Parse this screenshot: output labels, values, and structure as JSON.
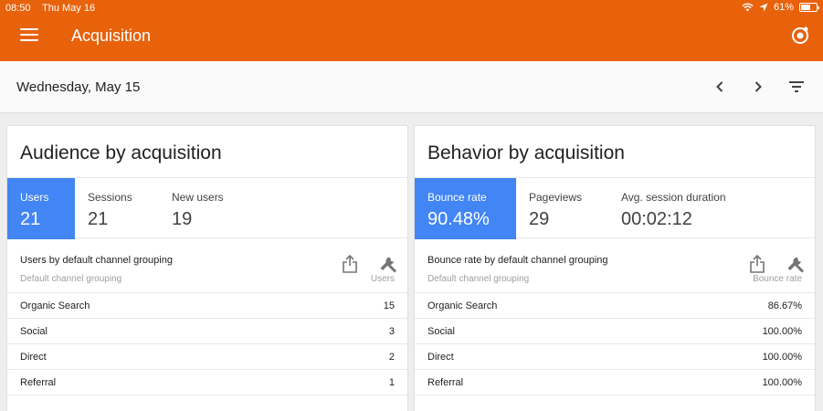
{
  "status_bar": {
    "time": "08:50",
    "date": "Thu May 16",
    "battery": "61%"
  },
  "app_bar": {
    "title": "Acquisition",
    "color": "#e8620c"
  },
  "date_bar": {
    "date": "Wednesday, May 15"
  },
  "audience_card": {
    "title": "Audience by acquisition",
    "metrics": [
      {
        "label": "Users",
        "value": "21"
      },
      {
        "label": "Sessions",
        "value": "21"
      },
      {
        "label": "New users",
        "value": "19"
      }
    ],
    "table": {
      "title": "Users by default channel grouping",
      "dimension": "Default channel grouping",
      "column": "Users",
      "rows": [
        {
          "name": "Organic Search",
          "value": "15"
        },
        {
          "name": "Social",
          "value": "3"
        },
        {
          "name": "Direct",
          "value": "2"
        },
        {
          "name": "Referral",
          "value": "1"
        }
      ]
    }
  },
  "behavior_card": {
    "title": "Behavior by acquisition",
    "metrics": [
      {
        "label": "Bounce rate",
        "value": "90.48%"
      },
      {
        "label": "Pageviews",
        "value": "29"
      },
      {
        "label": "Avg. session duration",
        "value": "00:02:12"
      }
    ],
    "table": {
      "title": "Bounce rate by default channel grouping",
      "dimension": "Default channel grouping",
      "column": "Bounce rate",
      "rows": [
        {
          "name": "Organic Search",
          "value": "86.67%"
        },
        {
          "name": "Social",
          "value": "100.00%"
        },
        {
          "name": "Direct",
          "value": "100.00%"
        },
        {
          "name": "Referral",
          "value": "100.00%"
        }
      ]
    }
  },
  "active_metric_color": "#4285f4"
}
